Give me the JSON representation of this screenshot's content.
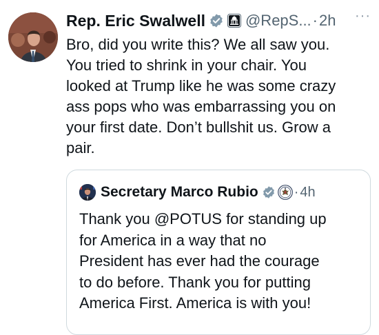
{
  "post": {
    "author_name": "Rep. Eric Swalwell",
    "handle": "@RepS...",
    "separator": "·",
    "time": "2h",
    "more_label": "···",
    "body_lines": [
      "Bro, did you write this? We all saw you.",
      "You tried to shrink in your chair. You",
      "looked at Trump like he was some crazy",
      "ass pops who was embarrassing you on",
      "your first date. Don’t bullshit us. Grow a",
      "pair."
    ]
  },
  "quoted_post": {
    "author_name": "Secretary Marco Rubio",
    "separator": "·",
    "time": "4h",
    "body_lines": [
      "Thank you @POTUS for standing up",
      "for America in a way that no",
      "President has ever had the courage",
      "to do before. Thank you for putting",
      "America First. America is with you!"
    ]
  },
  "icons": {
    "verified": "verified-badge-icon",
    "government": "capitol-building-icon",
    "seal": "state-department-seal-icon",
    "more": "more-options-icon"
  },
  "colors": {
    "text": "#0f1419",
    "secondary": "#536471",
    "verified_gray": "#829aab",
    "border": "#cfd9de"
  }
}
